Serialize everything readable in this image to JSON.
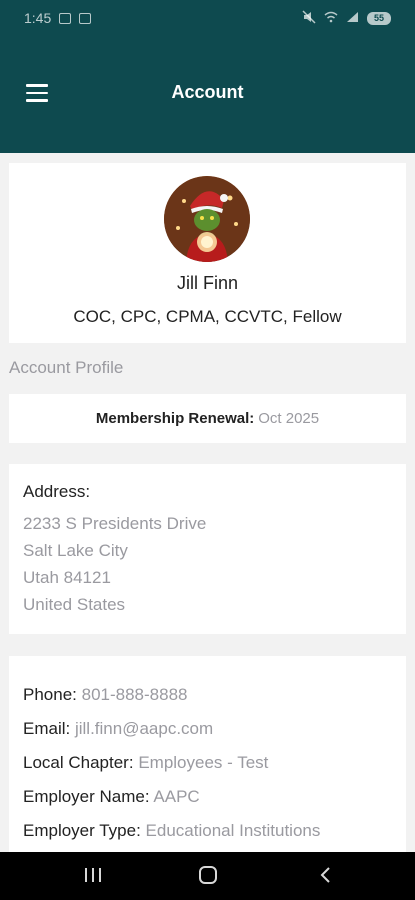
{
  "status_bar": {
    "time": "1:45",
    "battery": "55"
  },
  "app_bar": {
    "title": "Account",
    "menu_icon": "hamburger-menu-icon"
  },
  "profile": {
    "name": "Jill Finn",
    "credentials": "COC, CPC, CPMA, CCVTC, Fellow"
  },
  "section_heading": "Account Profile",
  "renewal": {
    "label": "Membership Renewal:",
    "value": "Oct 2025"
  },
  "address": {
    "label": "Address:",
    "lines": [
      "2233 S Presidents Drive",
      "Salt Lake City",
      "Utah 84121",
      "United States"
    ]
  },
  "contact": [
    {
      "label": "Phone:",
      "value": "801-888-8888"
    },
    {
      "label": "Email:",
      "value": "jill.finn@aapc.com"
    },
    {
      "label": "Local Chapter:",
      "value": "Employees - Test"
    },
    {
      "label": "Employer Name:",
      "value": "AAPC"
    },
    {
      "label": "Employer Type:",
      "value": "Educational Institutions"
    }
  ],
  "colors": {
    "header": "#0e4a4f",
    "muted_text": "#9a9aa0",
    "background": "#f2f2f2"
  }
}
